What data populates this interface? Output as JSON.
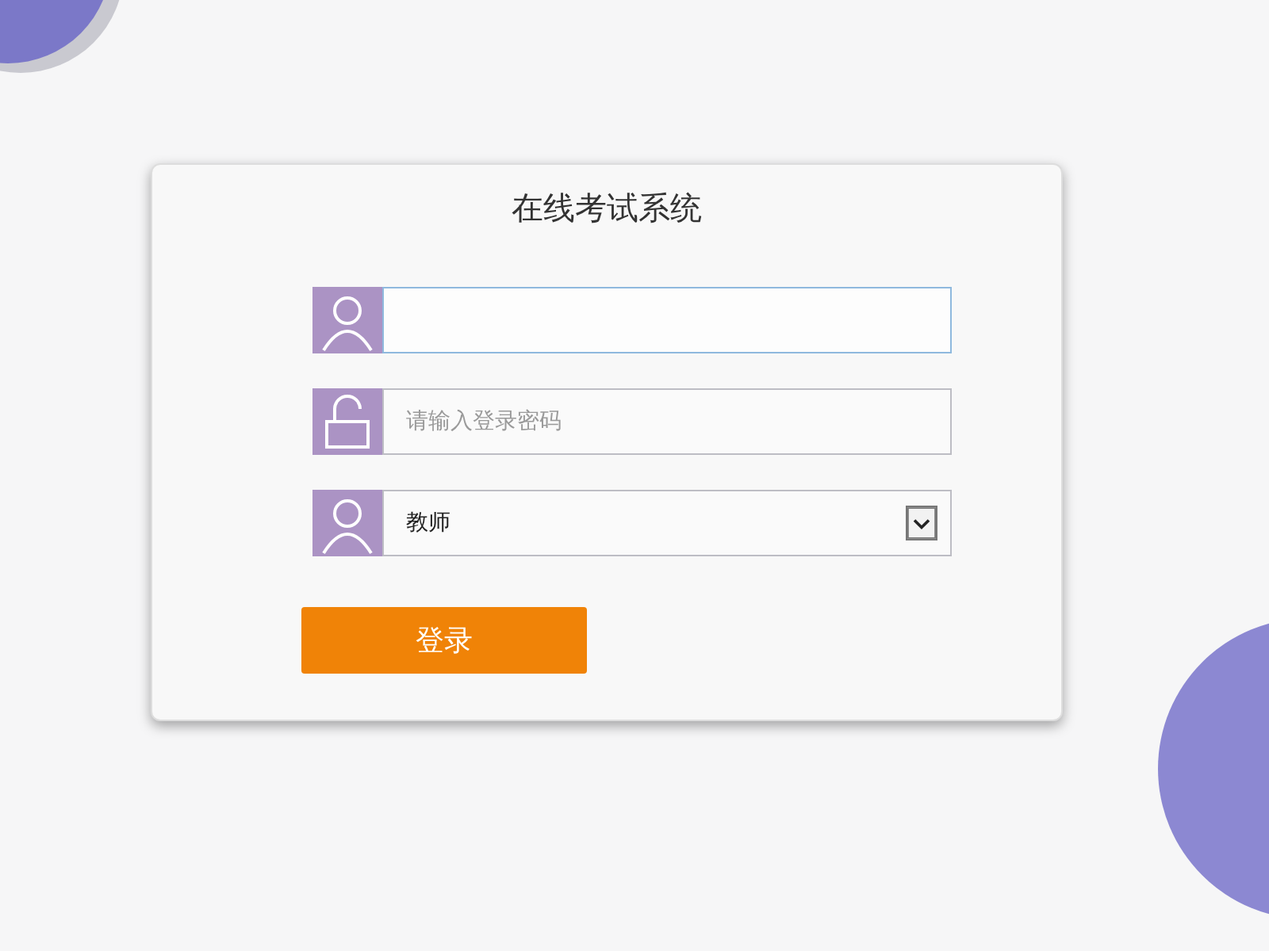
{
  "title": "在线考试系统",
  "fields": [
    {
      "kind": "text",
      "focused": true
    },
    {
      "kind": "password",
      "placeholder": "请输入登录密码",
      "focused": false
    },
    {
      "kind": "select",
      "value": "教师",
      "focused": false
    }
  ],
  "login_button": "登录"
}
